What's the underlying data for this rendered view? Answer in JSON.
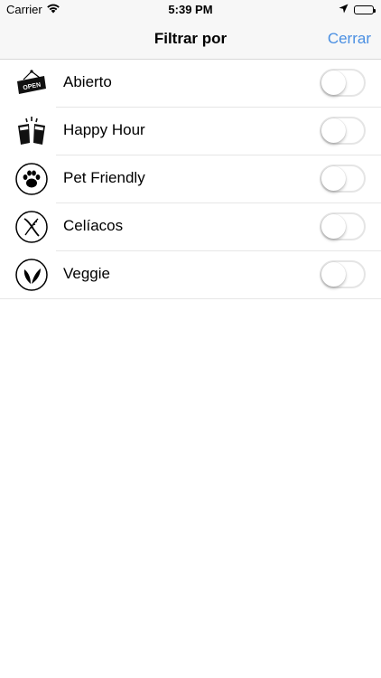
{
  "status_bar": {
    "carrier": "Carrier",
    "time": "5:39 PM",
    "icons": [
      "wifi-icon",
      "location-arrow-icon",
      "battery-icon"
    ]
  },
  "nav": {
    "title": "Filtrar por",
    "action_label": "Cerrar"
  },
  "filters": [
    {
      "label": "Abierto",
      "icon": "open-sign-icon",
      "enabled": false
    },
    {
      "label": "Happy Hour",
      "icon": "cheers-glasses-icon",
      "enabled": false
    },
    {
      "label": "Pet Friendly",
      "icon": "paw-icon",
      "enabled": false
    },
    {
      "label": "Celíacos",
      "icon": "gluten-free-icon",
      "enabled": false
    },
    {
      "label": "Veggie",
      "icon": "leaf-icon",
      "enabled": false
    }
  ],
  "colors": {
    "accent": "#4a8fe2",
    "bar_background": "#f7f7f7",
    "separator": "#e6e6e6"
  }
}
